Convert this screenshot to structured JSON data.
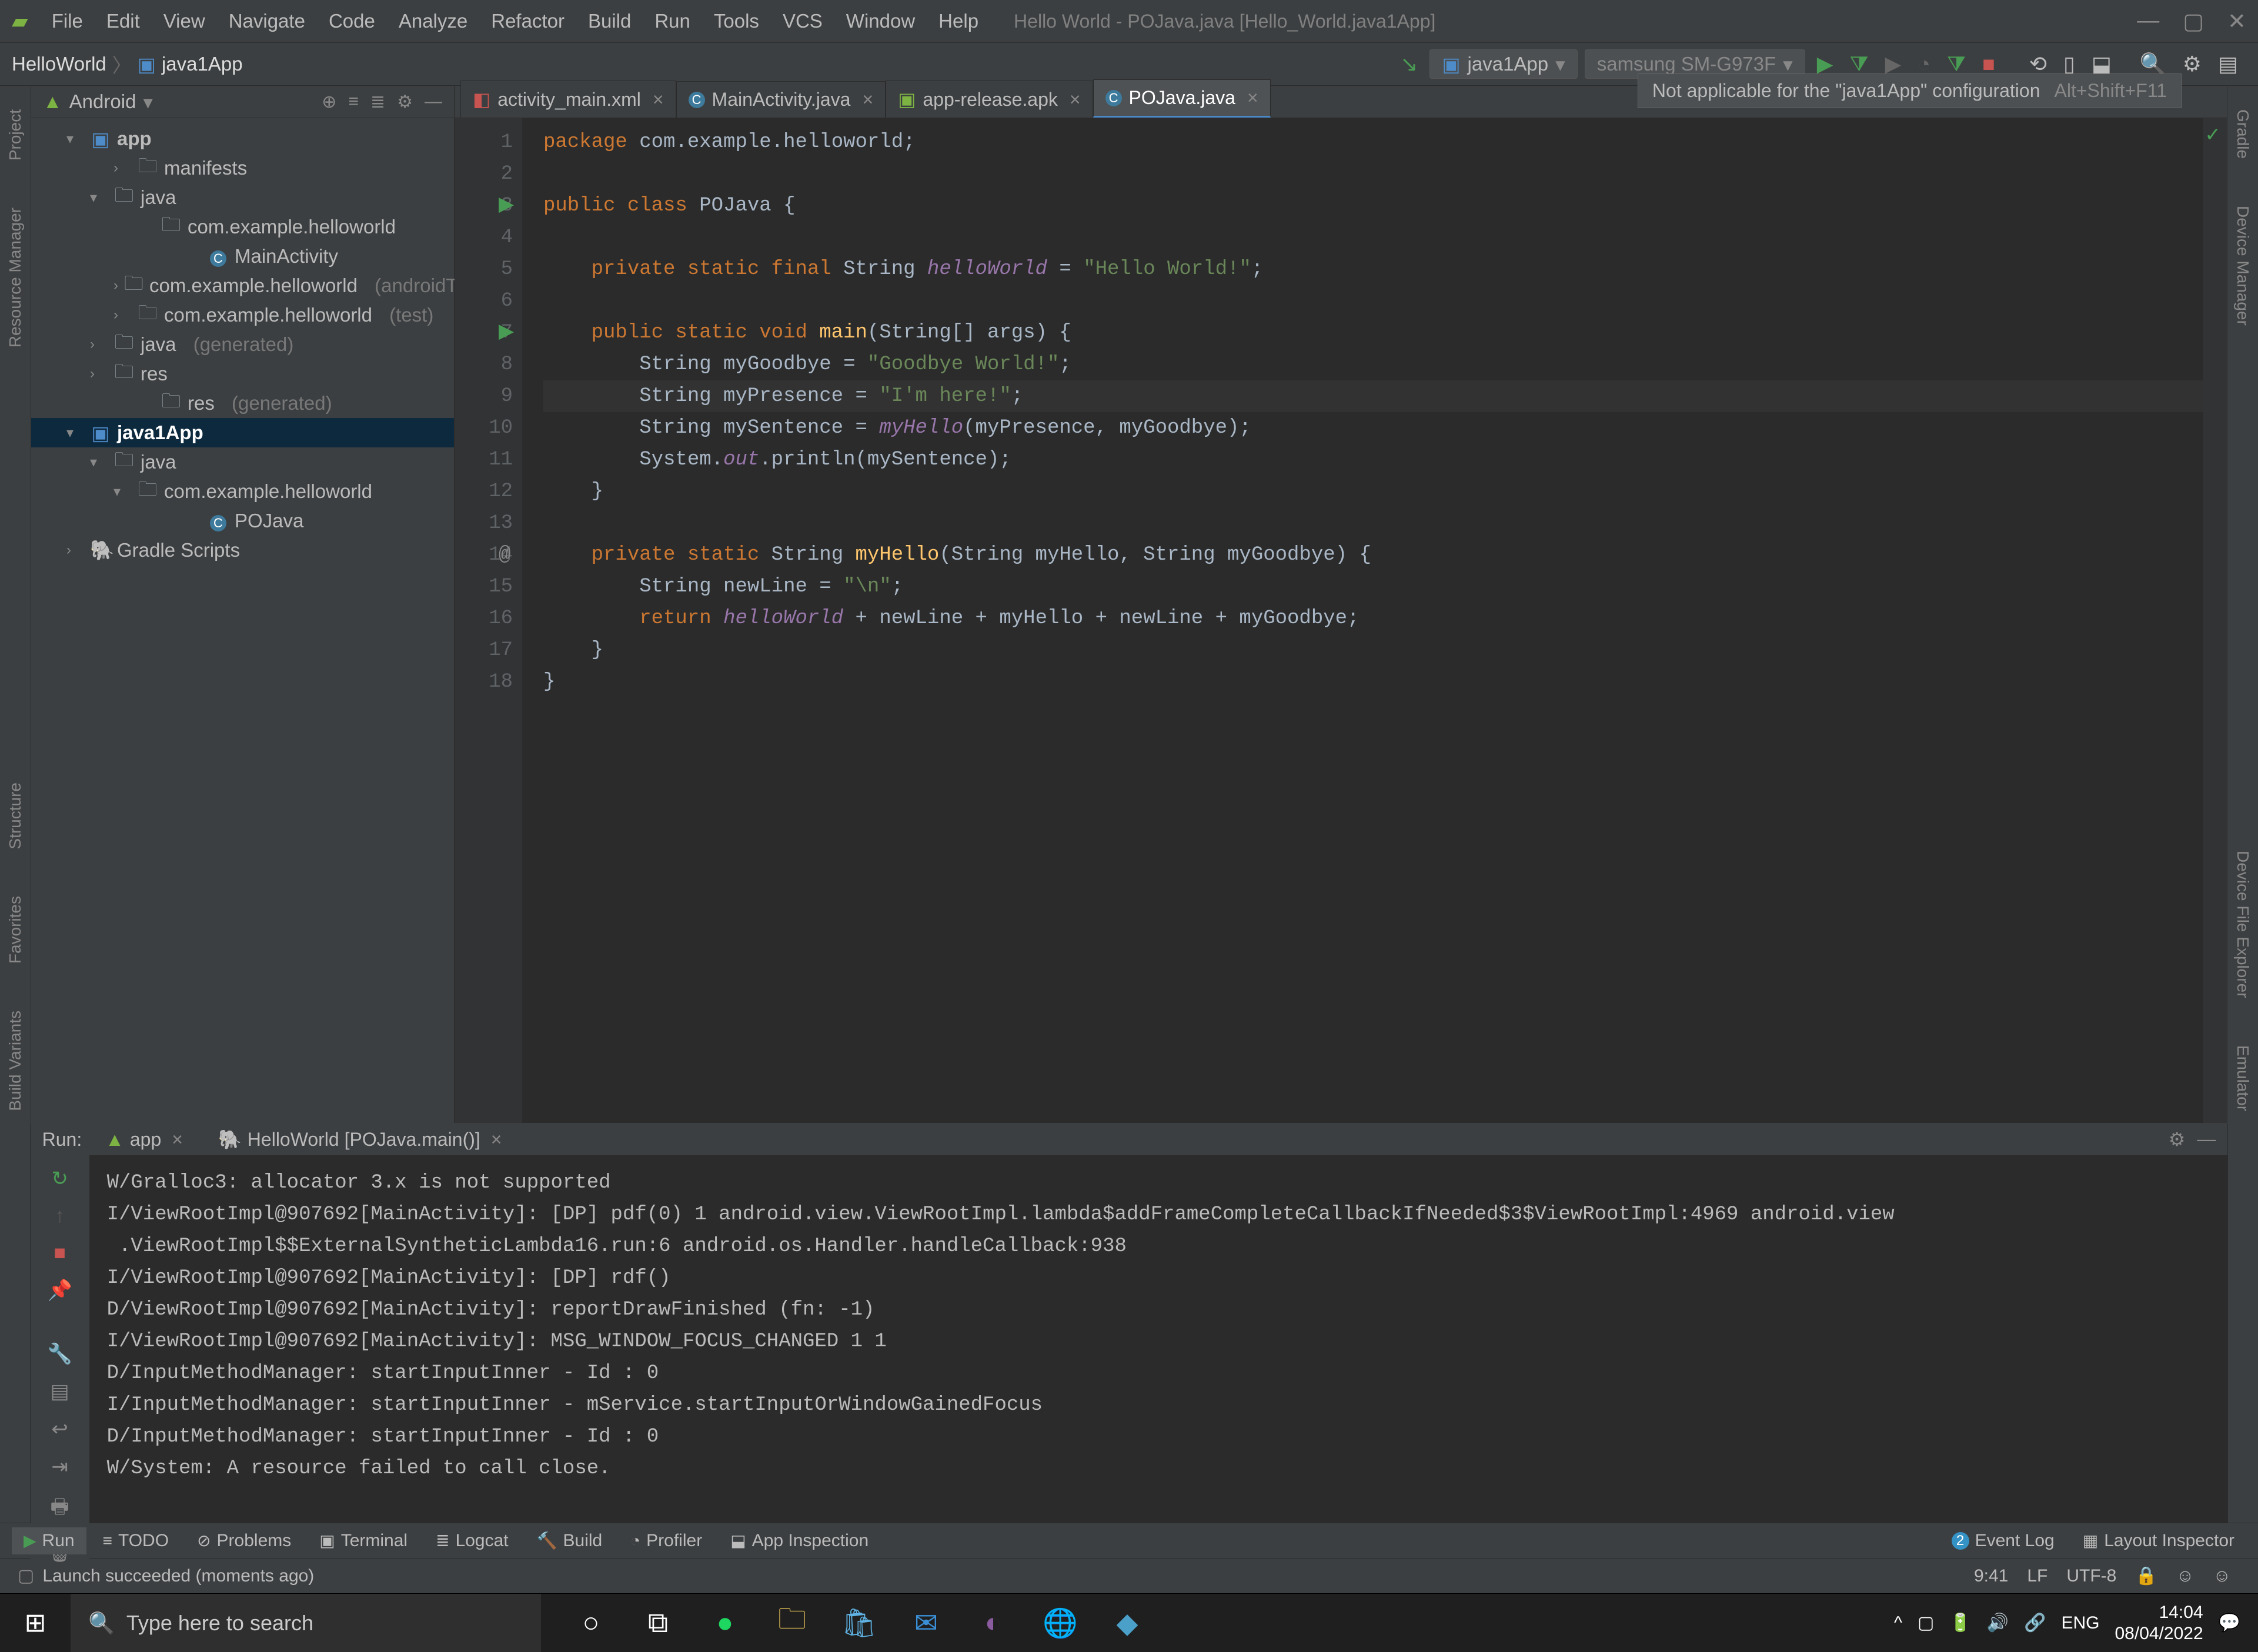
{
  "window": {
    "title": "Hello World - POJava.java [Hello_World.java1App]"
  },
  "menu": [
    "File",
    "Edit",
    "View",
    "Navigate",
    "Code",
    "Analyze",
    "Refactor",
    "Build",
    "Run",
    "Tools",
    "VCS",
    "Window",
    "Help"
  ],
  "breadcrumb": {
    "root": "HelloWorld",
    "module": "java1App"
  },
  "run_config": {
    "selected": "java1App",
    "device": "samsung SM-G973F"
  },
  "tooltip": {
    "text": "Not applicable for the \"java1App\" configuration",
    "shortcut": "Alt+Shift+F11"
  },
  "project": {
    "view": "Android",
    "tree": {
      "app": "app",
      "manifests": "manifests",
      "java": "java",
      "pkg1": "com.example.helloworld",
      "main_activity": "MainActivity",
      "pkg2": "com.example.helloworld",
      "pkg2_suffix": "(androidTest)",
      "pkg3": "com.example.helloworld",
      "pkg3_suffix": "(test)",
      "javagen": "java",
      "javagen_suffix": "(generated)",
      "res": "res",
      "resgen": "res",
      "resgen_suffix": "(generated)",
      "java1app": "java1App",
      "java2": "java",
      "pkg4": "com.example.helloworld",
      "pojava": "POJava",
      "gradle": "Gradle Scripts"
    }
  },
  "editor_tabs": [
    {
      "label": "activity_main.xml",
      "icon": "xml"
    },
    {
      "label": "MainActivity.java",
      "icon": "class"
    },
    {
      "label": "app-release.apk",
      "icon": "apk"
    },
    {
      "label": "POJava.java",
      "icon": "class",
      "active": true
    }
  ],
  "code": {
    "l1a": "package ",
    "l1b": "com.example.helloworld;",
    "l3a": "public class ",
    "l3b": "POJava {",
    "l5a": "    private static final ",
    "l5b": "String ",
    "l5c": "helloWorld",
    "l5d": " = ",
    "l5e": "\"Hello World!\"",
    "l5f": ";",
    "l7a": "    public static void ",
    "l7b": "main",
    "l7c": "(String[] args) {",
    "l8a": "        String myGoodbye = ",
    "l8b": "\"Goodbye World!\"",
    "l8c": ";",
    "l9a": "        String myPresence = ",
    "l9b": "\"I'm here!\"",
    "l9c": ";",
    "l10a": "        String mySentence = ",
    "l10b": "myHello",
    "l10c": "(myPresence, myGoodbye);",
    "l11a": "        System.",
    "l11b": "out",
    "l11c": ".println(mySentence);",
    "l12": "    }",
    "l14a": "    private static ",
    "l14b": "String ",
    "l14c": "myHello",
    "l14d": "(String myHello, String myGoodbye) {",
    "l15a": "        String newLine = ",
    "l15b": "\"\\n\"",
    "l15c": ";",
    "l16a": "        return ",
    "l16b": "helloWorld",
    "l16c": " + newLine + myHello + newLine + myGoodbye;",
    "l17": "    }",
    "l18": "}"
  },
  "run": {
    "label": "Run:",
    "tabs": [
      {
        "label": "app"
      },
      {
        "label": "HelloWorld [POJava.main()]"
      }
    ],
    "output": "W/Gralloc3: allocator 3.x is not supported\nI/ViewRootImpl@907692[MainActivity]: [DP] pdf(0) 1 android.view.ViewRootImpl.lambda$addFrameCompleteCallbackIfNeeded$3$ViewRootImpl:4969 android.view\n .ViewRootImpl$$ExternalSyntheticLambda16.run:6 android.os.Handler.handleCallback:938\nI/ViewRootImpl@907692[MainActivity]: [DP] rdf()\nD/ViewRootImpl@907692[MainActivity]: reportDrawFinished (fn: -1)\nI/ViewRootImpl@907692[MainActivity]: MSG_WINDOW_FOCUS_CHANGED 1 1\nD/InputMethodManager: startInputInner - Id : 0\nI/InputMethodManager: startInputInner - mService.startInputOrWindowGainedFocus\nD/InputMethodManager: startInputInner - Id : 0\nW/System: A resource failed to call close."
  },
  "bottom_tabs": {
    "run": "Run",
    "todo": "TODO",
    "problems": "Problems",
    "terminal": "Terminal",
    "logcat": "Logcat",
    "build": "Build",
    "profiler": "Profiler",
    "appinsp": "App Inspection",
    "eventlog": "Event Log",
    "eventcount": "2",
    "layoutinsp": "Layout Inspector"
  },
  "status": {
    "msg": "Launch succeeded (moments ago)",
    "pos": "9:41",
    "lf": "LF",
    "enc": "UTF-8"
  },
  "left_strip": [
    "Project",
    "Resource Manager"
  ],
  "left_strip2": [
    "Structure",
    "Favorites",
    "Build Variants"
  ],
  "right_strip": [
    "Gradle",
    "Device Manager"
  ],
  "right_strip2": [
    "Device File Explorer",
    "Emulator"
  ],
  "taskbar": {
    "search": "Type here to search",
    "lang": "ENG",
    "time": "14:04",
    "date": "08/04/2022"
  }
}
